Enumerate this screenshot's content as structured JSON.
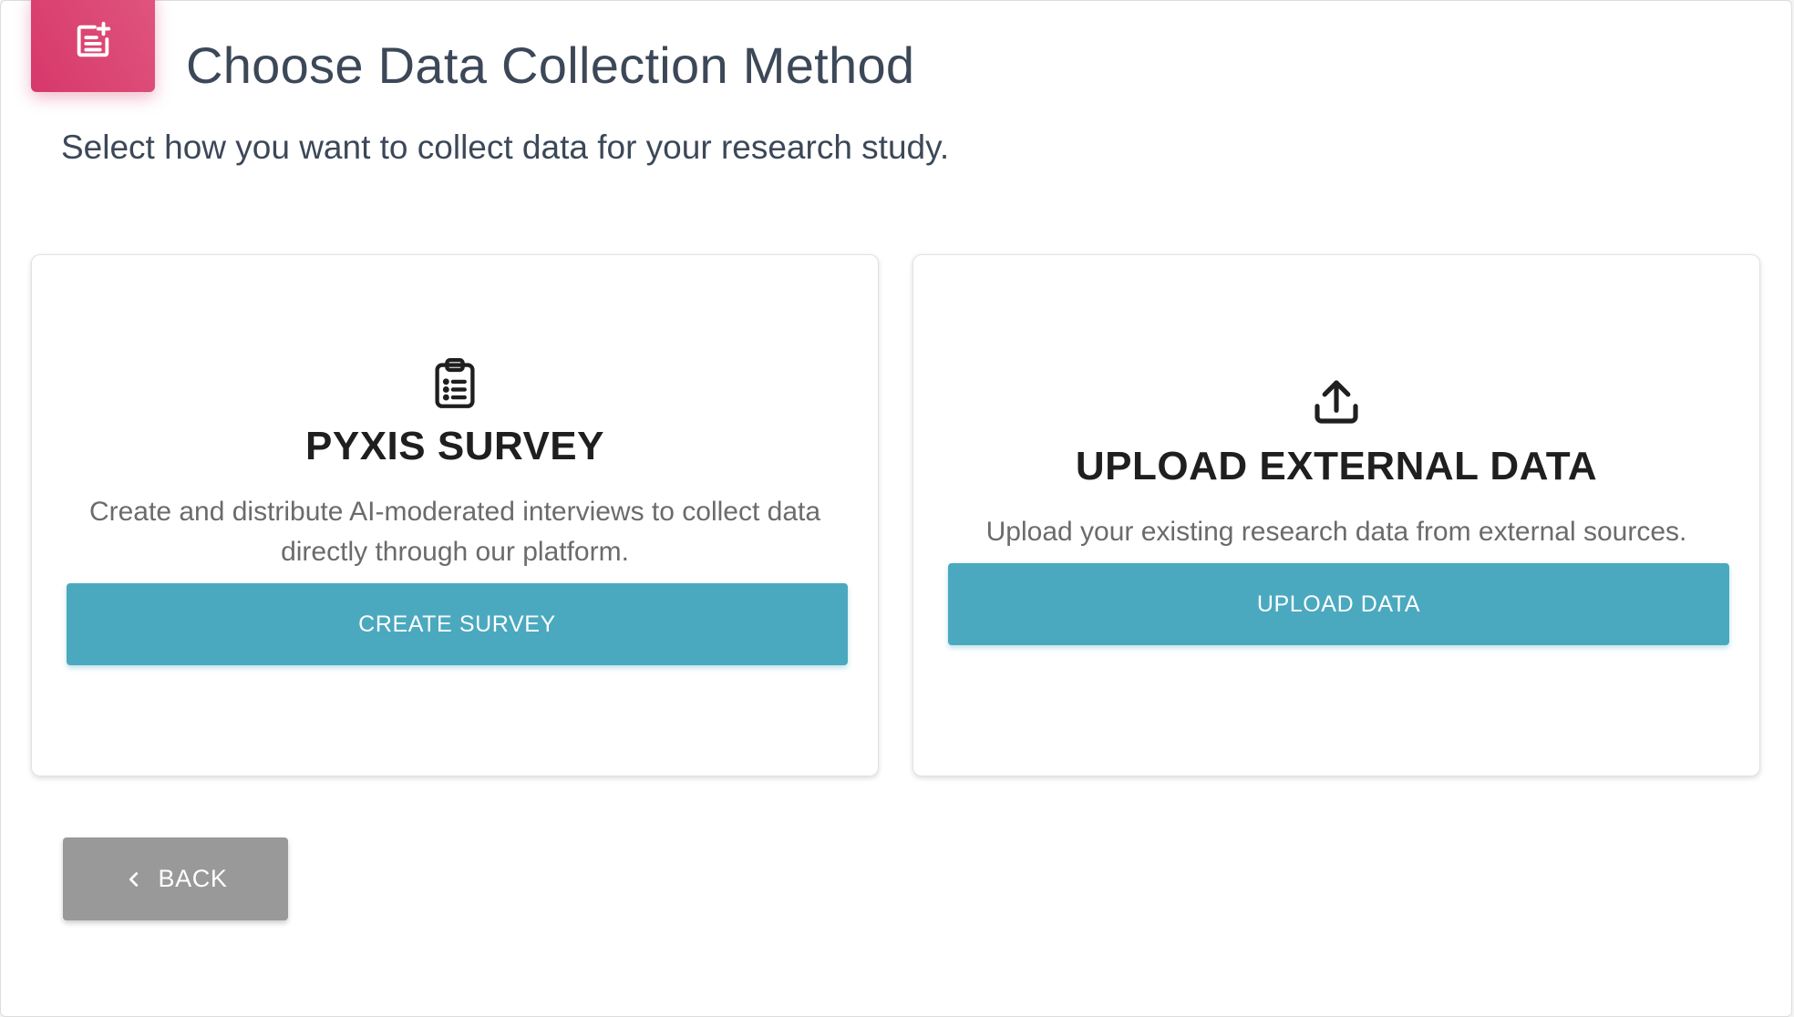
{
  "header": {
    "icon": "post-add-icon",
    "title": "Choose Data Collection Method",
    "subtitle": "Select how you want to collect data for your research study.",
    "accent_color": "#d6386b"
  },
  "cards": [
    {
      "icon": "clipboard-list-icon",
      "title": "PYXIS SURVEY",
      "description": "Create and distribute AI-moderated interviews to collect data directly through our platform.",
      "button_label": "CREATE SURVEY"
    },
    {
      "icon": "upload-icon",
      "title": "UPLOAD EXTERNAL DATA",
      "description": "Upload your existing research data from external sources.",
      "button_label": "UPLOAD DATA"
    }
  ],
  "button_color": "#4aa9bf",
  "back": {
    "icon": "chevron-left-icon",
    "label": "BACK",
    "color": "#999999"
  }
}
